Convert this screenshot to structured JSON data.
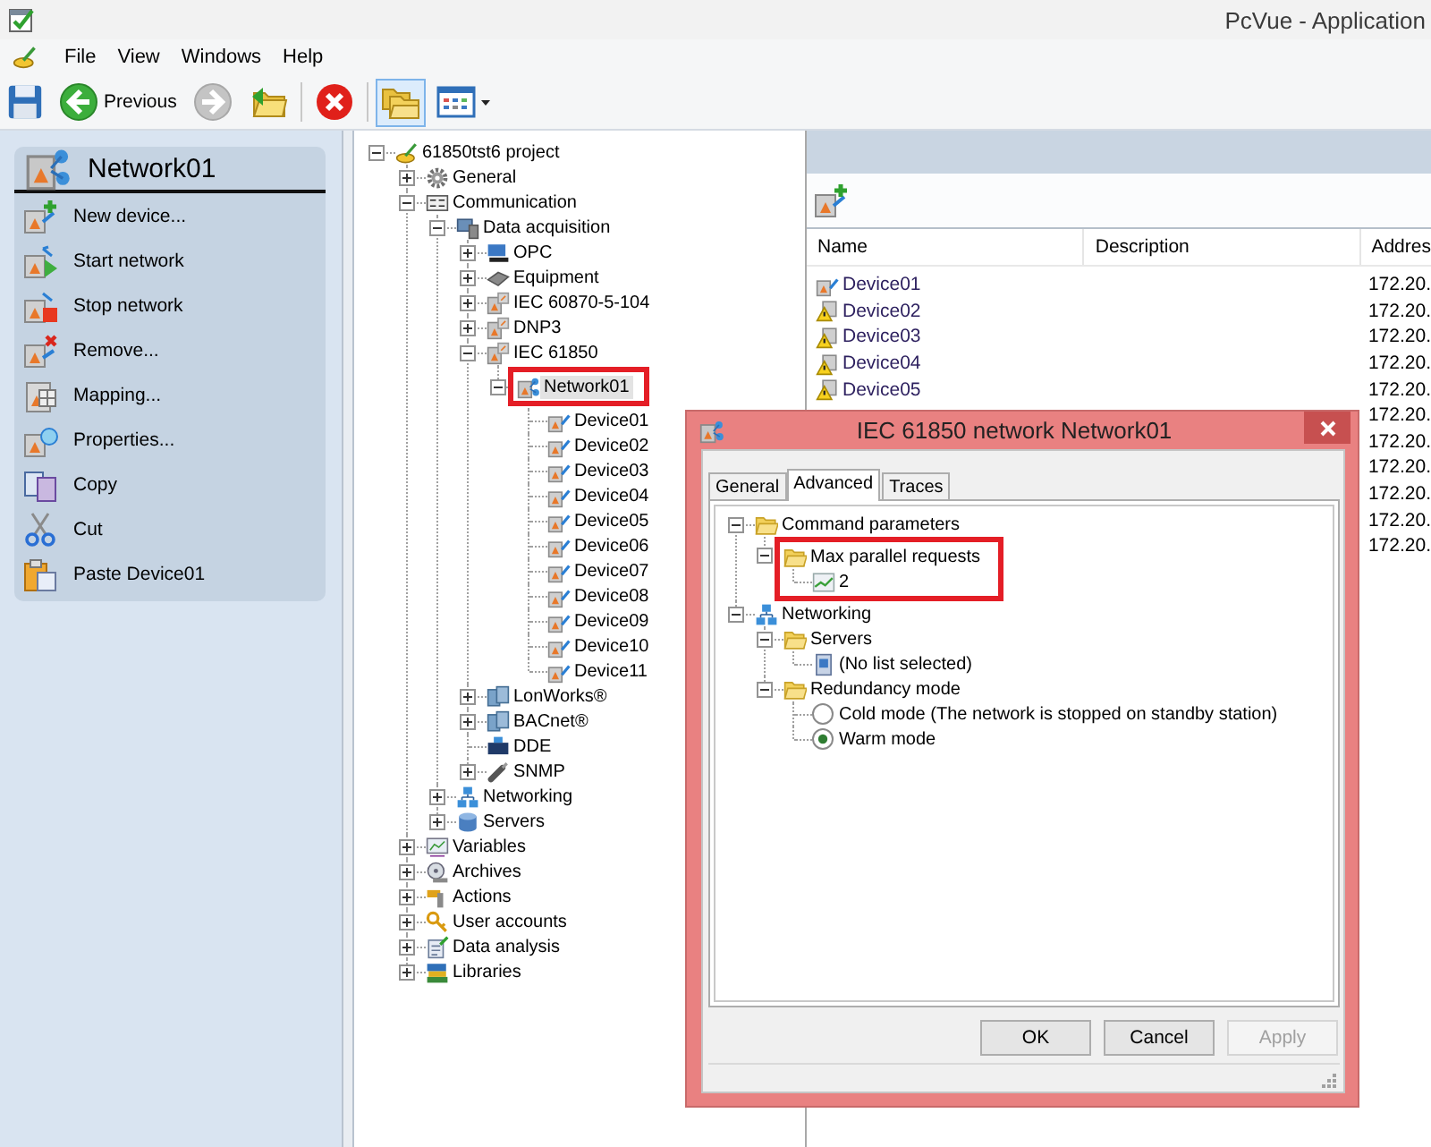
{
  "window": {
    "title": "PcVue - Application"
  },
  "menu": [
    {
      "label": "File"
    },
    {
      "label": "View"
    },
    {
      "label": "Windows"
    },
    {
      "label": "Help"
    }
  ],
  "toolbar": [
    {
      "kind": "save",
      "disabled": false,
      "pressed": false
    },
    {
      "kind": "back",
      "label": "Previous",
      "disabled": false,
      "pressed": false
    },
    {
      "kind": "forward",
      "disabled": true,
      "pressed": false
    },
    {
      "kind": "import",
      "disabled": false,
      "pressed": false
    },
    {
      "kind": "separator"
    },
    {
      "kind": "delete",
      "disabled": false,
      "pressed": false
    },
    {
      "kind": "separator"
    },
    {
      "kind": "explorer",
      "disabled": false,
      "pressed": true
    },
    {
      "kind": "layout",
      "disabled": false,
      "pressed": false
    }
  ],
  "task_pane": {
    "title": "Network01",
    "items": [
      {
        "kind": "new-device",
        "label": "New device..."
      },
      {
        "kind": "start",
        "label": "Start network"
      },
      {
        "kind": "stop",
        "label": "Stop network"
      },
      {
        "kind": "remove",
        "label": "Remove..."
      },
      {
        "kind": "mapping",
        "label": "Mapping..."
      },
      {
        "kind": "properties",
        "label": "Properties..."
      },
      {
        "kind": "copy",
        "label": "Copy"
      },
      {
        "kind": "cut",
        "label": "Cut"
      },
      {
        "kind": "paste",
        "label": "Paste Device01"
      }
    ]
  },
  "tree": [
    {
      "label": "61850tst6 project",
      "kind": "project",
      "expanded": true,
      "selected": false,
      "highlighted": false,
      "children": [
        {
          "label": "General",
          "kind": "settings",
          "expanded": false,
          "selected": false,
          "highlighted": false
        },
        {
          "label": "Communication",
          "kind": "communication",
          "expanded": true,
          "selected": false,
          "highlighted": false,
          "children": [
            {
              "label": "Data acquisition",
              "kind": "acquisition",
              "expanded": true,
              "selected": false,
              "highlighted": false,
              "children": [
                {
                  "label": "OPC",
                  "kind": "opc",
                  "expanded": false,
                  "selected": false,
                  "highlighted": false
                },
                {
                  "label": "Equipment",
                  "kind": "equipment",
                  "expanded": false,
                  "selected": false,
                  "highlighted": false
                },
                {
                  "label": "IEC 60870-5-104",
                  "kind": "protocol",
                  "expanded": false,
                  "selected": false,
                  "highlighted": false
                },
                {
                  "label": "DNP3",
                  "kind": "protocol",
                  "expanded": false,
                  "selected": false,
                  "highlighted": false
                },
                {
                  "label": "IEC 61850",
                  "kind": "protocol",
                  "expanded": true,
                  "selected": false,
                  "highlighted": false,
                  "children": [
                    {
                      "label": "Network01",
                      "kind": "network",
                      "expanded": true,
                      "selected": true,
                      "highlighted": true,
                      "children": [
                        {
                          "label": "Device01",
                          "kind": "device",
                          "selected": false,
                          "highlighted": false
                        },
                        {
                          "label": "Device02",
                          "kind": "device",
                          "selected": false,
                          "highlighted": false
                        },
                        {
                          "label": "Device03",
                          "kind": "device",
                          "selected": false,
                          "highlighted": false
                        },
                        {
                          "label": "Device04",
                          "kind": "device",
                          "selected": false,
                          "highlighted": false
                        },
                        {
                          "label": "Device05",
                          "kind": "device",
                          "selected": false,
                          "highlighted": false
                        },
                        {
                          "label": "Device06",
                          "kind": "device",
                          "selected": false,
                          "highlighted": false
                        },
                        {
                          "label": "Device07",
                          "kind": "device",
                          "selected": false,
                          "highlighted": false
                        },
                        {
                          "label": "Device08",
                          "kind": "device",
                          "selected": false,
                          "highlighted": false
                        },
                        {
                          "label": "Device09",
                          "kind": "device",
                          "selected": false,
                          "highlighted": false
                        },
                        {
                          "label": "Device10",
                          "kind": "device",
                          "selected": false,
                          "highlighted": false
                        },
                        {
                          "label": "Device11",
                          "kind": "device",
                          "selected": false,
                          "highlighted": false
                        }
                      ]
                    }
                  ]
                },
                {
                  "label": "LonWorks®",
                  "kind": "fieldbus",
                  "expanded": false,
                  "selected": false,
                  "highlighted": false
                },
                {
                  "label": "BACnet®",
                  "kind": "fieldbus",
                  "expanded": false,
                  "selected": false,
                  "highlighted": false
                },
                {
                  "label": "DDE",
                  "kind": "dde",
                  "selected": false,
                  "highlighted": false
                },
                {
                  "label": "SNMP",
                  "kind": "snmp",
                  "expanded": false,
                  "selected": false,
                  "highlighted": false
                }
              ]
            },
            {
              "label": "Networking",
              "kind": "networking",
              "expanded": false,
              "selected": false,
              "highlighted": false
            },
            {
              "label": "Servers",
              "kind": "servers",
              "expanded": false,
              "selected": false,
              "highlighted": false
            }
          ]
        },
        {
          "label": "Variables",
          "kind": "variables",
          "expanded": false,
          "selected": false,
          "highlighted": false
        },
        {
          "label": "Archives",
          "kind": "archives",
          "expanded": false,
          "selected": false,
          "highlighted": false
        },
        {
          "label": "Actions",
          "kind": "actions",
          "expanded": false,
          "selected": false,
          "highlighted": false
        },
        {
          "label": "User accounts",
          "kind": "users",
          "expanded": false,
          "selected": false,
          "highlighted": false
        },
        {
          "label": "Data analysis",
          "kind": "analysis",
          "expanded": false,
          "selected": false,
          "highlighted": false
        },
        {
          "label": "Libraries",
          "kind": "libraries",
          "expanded": false,
          "selected": false,
          "highlighted": false
        }
      ]
    }
  ],
  "device_list": {
    "columns": [
      {
        "label": "Name"
      },
      {
        "label": "Description"
      },
      {
        "label": "Addres"
      }
    ],
    "rows": [
      {
        "name": "Device01",
        "warning": false,
        "column_3": "172.20."
      },
      {
        "name": "Device02",
        "warning": true,
        "column_3": "172.20."
      },
      {
        "name": "Device03",
        "warning": true,
        "column_3": "172.20."
      },
      {
        "name": "Device04",
        "warning": true,
        "column_3": "172.20."
      },
      {
        "name": "Device05",
        "warning": true,
        "column_3": "172.20."
      },
      {
        "column_3": "172.20."
      },
      {
        "column_3": "172.20."
      },
      {
        "column_3": "172.20."
      },
      {
        "column_3": "172.20."
      },
      {
        "column_3": "172.20."
      },
      {
        "column_3": "172.20."
      }
    ]
  },
  "dialog": {
    "title": "IEC 61850 network Network01",
    "tabs": [
      {
        "label": "General",
        "selected": false
      },
      {
        "label": "Advanced",
        "selected": true
      },
      {
        "label": "Traces",
        "selected": false
      }
    ],
    "tree": [
      {
        "label": "Command parameters",
        "kind": "folder",
        "expanded": true,
        "highlighted": false,
        "children": [
          {
            "label": "Max parallel requests",
            "kind": "folder",
            "expanded": true,
            "highlighted": true,
            "children": [
              {
                "label": "2",
                "kind": "value",
                "highlighted": true
              }
            ]
          }
        ]
      },
      {
        "label": "Networking",
        "kind": "networking",
        "expanded": true,
        "highlighted": false,
        "children": [
          {
            "label": "Servers",
            "kind": "folder",
            "expanded": true,
            "highlighted": false,
            "children": [
              {
                "label": "(No list selected)",
                "kind": "list",
                "highlighted": false
              }
            ]
          },
          {
            "label": "Redundancy mode",
            "kind": "folder",
            "expanded": true,
            "highlighted": false,
            "children": [
              {
                "label": "Cold mode (The network is stopped on standby station)",
                "kind": "radio",
                "selected": false,
                "highlighted": false
              },
              {
                "label": "Warm mode",
                "kind": "radio",
                "selected": true,
                "highlighted": false
              }
            ]
          }
        ]
      }
    ],
    "buttons": [
      {
        "label": "OK",
        "disabled": false
      },
      {
        "label": "Cancel",
        "disabled": false
      },
      {
        "label": "Apply",
        "disabled": true
      }
    ]
  }
}
